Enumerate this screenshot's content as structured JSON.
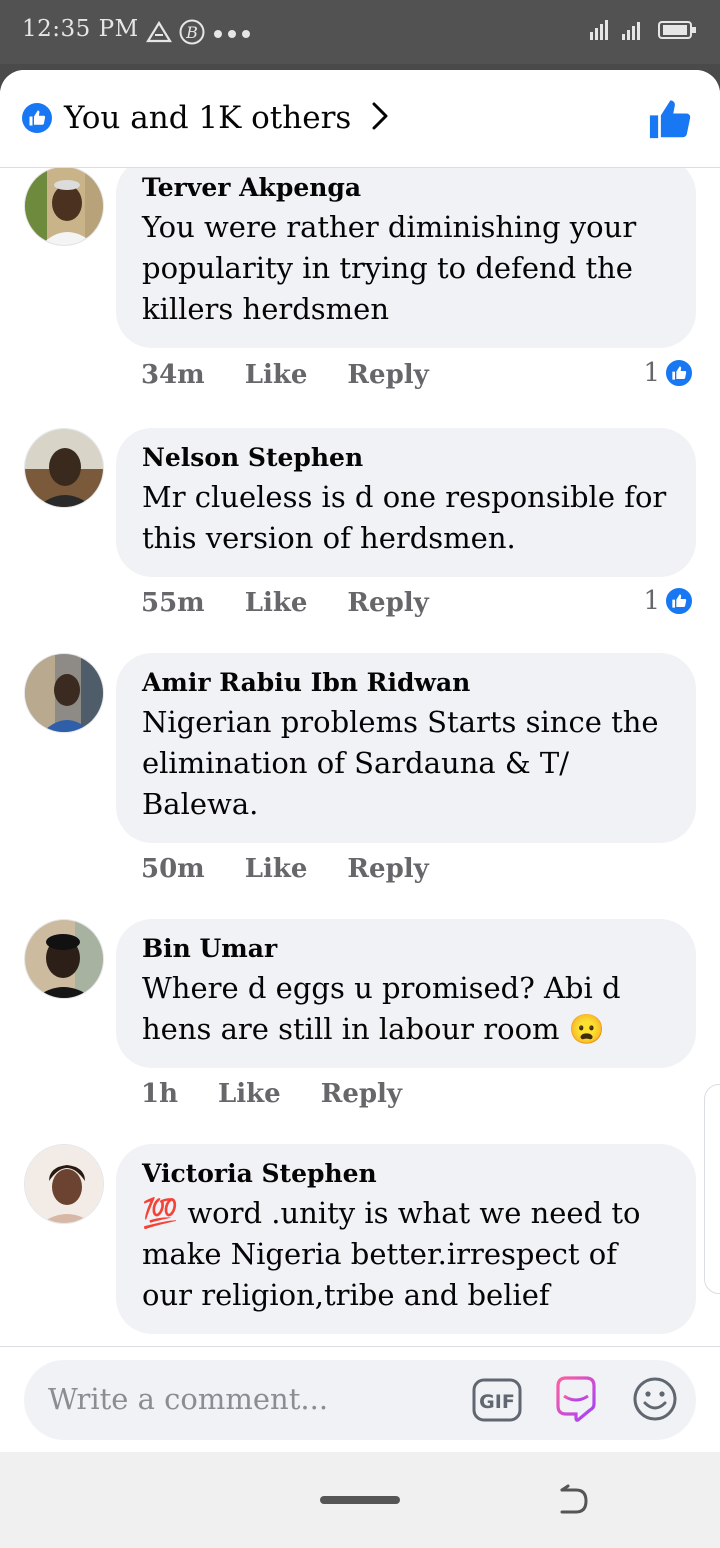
{
  "status_bar": {
    "time": "12:35 PM",
    "icons": [
      "warning-icon",
      "b-circle-icon",
      "more-dots-icon",
      "signal-icon",
      "battery-icon"
    ]
  },
  "header": {
    "reactions_label": "You and 1K others"
  },
  "comments": [
    {
      "author": "Terver Akpenga",
      "text": "You were rather diminishing your popularity in trying to defend the killers herdsmen",
      "time": "34m",
      "like": "Like",
      "reply": "Reply",
      "reactions": "1"
    },
    {
      "author": "Nelson Stephen",
      "text": "Mr clueless is d one responsible for this version of herdsmen.",
      "time": "55m",
      "like": "Like",
      "reply": "Reply",
      "reactions": "1"
    },
    {
      "author": "Amir Rabiu Ibn Ridwan",
      "text": "Nigerian problems Starts since the elimination of Sardauna & T/ Balewa.",
      "time": "50m",
      "like": "Like",
      "reply": "Reply"
    },
    {
      "author": "Bin Umar",
      "text": "Where d eggs u promised? Abi d hens are still in labour room 😦",
      "time": "1h",
      "like": "Like",
      "reply": "Reply"
    },
    {
      "author": "Victoria Stephen",
      "text": "💯 word .unity is what we need to make Nigeria better.irrespect of our religion,tribe and belief"
    }
  ],
  "composer": {
    "placeholder": "Write a comment...",
    "gif_label": "GIF"
  },
  "colors": {
    "accent": "#1877f2",
    "bubble": "#f0f2f5",
    "meta_text": "#65676b"
  }
}
